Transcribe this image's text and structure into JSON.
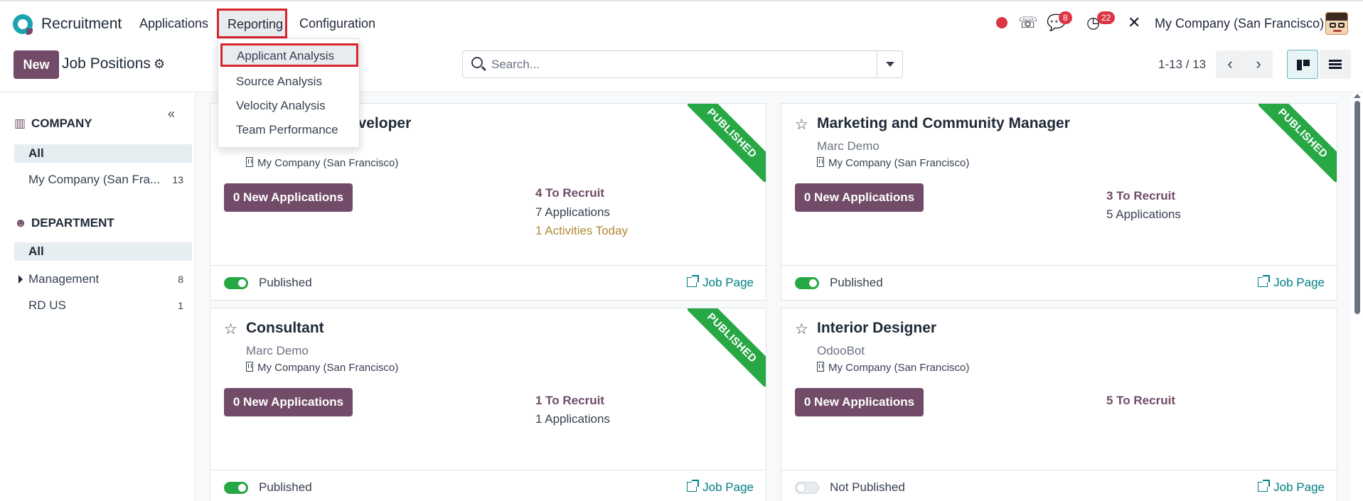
{
  "navbar": {
    "app_name": "Recruitment",
    "menus": [
      "Applications",
      "Reporting",
      "Configuration"
    ],
    "chat_badge": "8",
    "activity_badge": "22",
    "company": "My Company (San Francisco)"
  },
  "reporting_menu": {
    "items": [
      "Applicant Analysis",
      "Source Analysis",
      "Velocity Analysis",
      "Team Performance"
    ]
  },
  "control": {
    "new_label": "New",
    "title": "Job Positions",
    "search_placeholder": "Search...",
    "pager": "1-13 / 13"
  },
  "sidebar": {
    "company_heading": "COMPANY",
    "company_all": "All",
    "company_items": [
      {
        "label": "My Company (San Fra...",
        "count": "13"
      }
    ],
    "department_heading": "DEPARTMENT",
    "department_all": "All",
    "department_items": [
      {
        "label": "Management",
        "count": "8"
      },
      {
        "label": "RD US",
        "count": "1"
      }
    ]
  },
  "cards": [
    {
      "title": "Experienced Developer",
      "subtitle": "",
      "company": "My Company (San Francisco)",
      "new_apps": "0 New Applications",
      "to_recruit": "4 To Recruit",
      "applications": "7 Applications",
      "activities": "1 Activities Today",
      "ribbon": "PUBLISHED",
      "status": "Published",
      "job_page": "Job Page"
    },
    {
      "title": "Marketing and Community Manager",
      "subtitle": "Marc Demo",
      "company": "My Company (San Francisco)",
      "new_apps": "0 New Applications",
      "to_recruit": "3 To Recruit",
      "applications": "5 Applications",
      "ribbon": "PUBLISHED",
      "status": "Published",
      "job_page": "Job Page"
    },
    {
      "title": "Consultant",
      "subtitle": "Marc Demo",
      "company": "My Company (San Francisco)",
      "new_apps": "0 New Applications",
      "to_recruit": "1 To Recruit",
      "applications": "1 Applications",
      "ribbon": "PUBLISHED",
      "status": "Published",
      "job_page": "Job Page"
    },
    {
      "title": "Interior Designer",
      "subtitle": "OdooBot",
      "company": "My Company (San Francisco)",
      "new_apps": "0 New Applications",
      "to_recruit": "5 To Recruit",
      "status": "Not Published",
      "job_page": "Job Page"
    }
  ]
}
